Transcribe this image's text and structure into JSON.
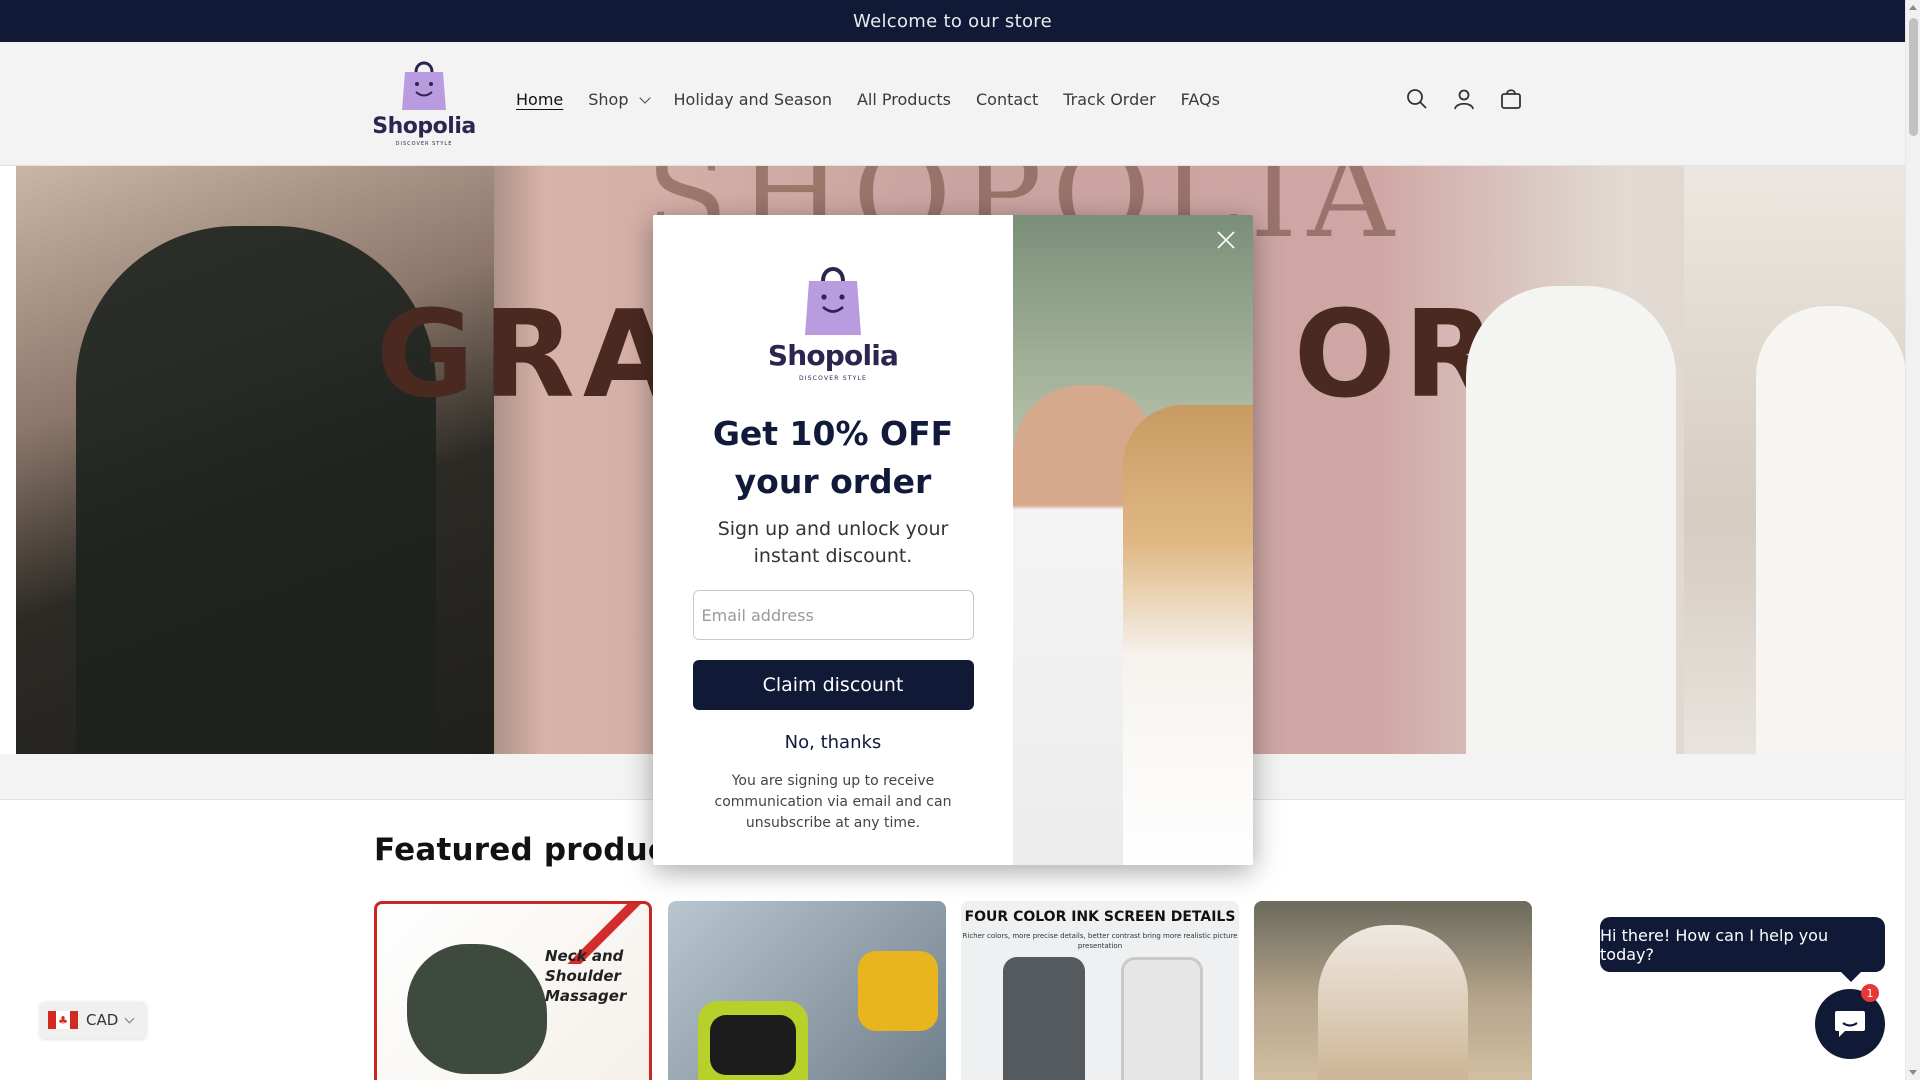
{
  "announcement": {
    "text": "Welcome to our store"
  },
  "brand": {
    "name": "Shopolia",
    "tagline": "DISCOVER STYLE"
  },
  "nav": {
    "items": [
      {
        "label": "Home",
        "active": true
      },
      {
        "label": "Shop",
        "dropdown": true
      },
      {
        "label": "Holiday and Season"
      },
      {
        "label": "All Products"
      },
      {
        "label": "Contact"
      },
      {
        "label": "Track Order"
      },
      {
        "label": "FAQs"
      }
    ]
  },
  "header_icons": [
    "search-icon",
    "account-icon",
    "cart-icon"
  ],
  "hero": {
    "brand_text": "SHOPOLIA",
    "big_left": "GRA",
    "big_right": "ORE",
    "big_letter": "S"
  },
  "featured": {
    "title": "Featured products",
    "products": [
      {
        "image_text": "Neck and Shoulder Massager"
      },
      {
        "image_text": ""
      },
      {
        "image_text": "FOUR COLOR INK SCREEN DETAILS",
        "image_sub": "Richer colors, more precise details, better contrast bring more realistic picture presentation"
      },
      {
        "image_text": ""
      }
    ]
  },
  "modal": {
    "headline": "Get 10% OFF your order",
    "subtext": "Sign up and unlock your instant discount.",
    "email_placeholder": "Email address",
    "claim_label": "Claim discount",
    "decline_label": "No, thanks",
    "legal": "You are signing up to receive communication via email and can unsubscribe at any time."
  },
  "currency": {
    "code": "CAD",
    "flag": "canada-flag-icon"
  },
  "chat": {
    "greeting": "Hi there! How can I help you today?",
    "badge_count": "1"
  },
  "colors": {
    "navy": "#101935",
    "brand_purple": "#b99be0",
    "brand_text": "#2b2550",
    "badge_red": "#e53935"
  }
}
